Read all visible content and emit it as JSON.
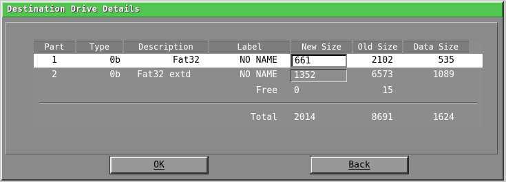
{
  "dialog": {
    "title": "Destination Drive Details"
  },
  "table": {
    "columns": [
      "Part",
      "Type",
      "Description",
      "Label",
      "New Size",
      "Old Size",
      "Data Size"
    ],
    "rows": [
      {
        "part": "1",
        "type": "0b",
        "description": "Fat32",
        "label": "NO NAME",
        "new_size": "661",
        "old_size": "2102",
        "data_size": "535",
        "selected": true
      },
      {
        "part": "2",
        "type": "0b",
        "description": "Fat32 extd",
        "label": "NO NAME",
        "new_size": "1352",
        "old_size": "6573",
        "data_size": "1089",
        "selected": false
      }
    ],
    "free": {
      "label": "Free",
      "new_size": "0",
      "old_size": "15"
    },
    "total": {
      "label": "Total",
      "new_size": "2014",
      "old_size": "8691",
      "data_size": "1624"
    }
  },
  "buttons": {
    "ok": "OK",
    "back": "Back"
  },
  "colors": {
    "title_bar": "#53c651",
    "window": "#8a8a8a",
    "selected_row": "#ffffff"
  }
}
